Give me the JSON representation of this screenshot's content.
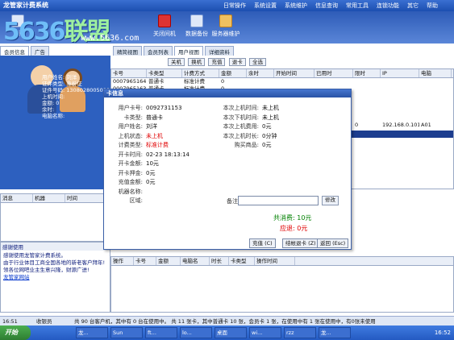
{
  "window": {
    "title": "龙管家计费系统"
  },
  "menubar": [
    "日常操作",
    "系统设置",
    "系统维护",
    "信息查询",
    "常用工具",
    "连锁功能",
    "其它",
    "帮助"
  ],
  "toolbar": {
    "items": [
      "新",
      "关闭间机",
      "数据备份",
      "服务器维护"
    ]
  },
  "logo": {
    "digits": "5636",
    "cn": "联盟",
    "website": "www.5636.com"
  },
  "left_tabs": [
    "会员信息",
    "广告"
  ],
  "top_tabs": [
    "精简视图",
    "会员列表",
    "用户视图",
    "详细资料"
  ],
  "action_buttons": [
    "关机",
    "换机",
    "充值",
    "退卡",
    "全选"
  ],
  "user_panel": {
    "fields": [
      {
        "label": "用户姓名:",
        "value": "刘洋"
      },
      {
        "label": "证件类型:",
        "value": "身份证"
      },
      {
        "label": "证件号码:",
        "value": "130802800508021"
      },
      {
        "label": "上机时间:",
        "value": ""
      },
      {
        "label": "金额:",
        "value": "0"
      },
      {
        "label": "余时:",
        "value": ""
      },
      {
        "label": "电脑名称:",
        "value": ""
      }
    ]
  },
  "grid": {
    "columns": [
      "卡号",
      "卡类型",
      "计费方式",
      "金额",
      "余时",
      "开始时间",
      "已用时",
      "限时",
      "IP",
      "电脑"
    ],
    "rows": [
      [
        "0007965164",
        "普通卡",
        "标准计费",
        "0",
        "",
        "",
        "",
        "",
        "",
        ""
      ],
      [
        "0007965163",
        "普通卡",
        "标准计费",
        "0",
        "",
        "",
        "",
        "",
        "",
        ""
      ],
      [
        "",
        "",
        "",
        "",
        "",
        "",
        "",
        "0",
        "192.168.0.101",
        "A01"
      ]
    ]
  },
  "msg_grid": {
    "columns": [
      "消息",
      "机器",
      "时间"
    ]
  },
  "log_grid": {
    "columns": [
      "操作",
      "卡号",
      "金额",
      "电脑名",
      "时长",
      "卡类型",
      "操作时间"
    ]
  },
  "welcome": {
    "title": "感谢使用",
    "lines": [
      "感谢使用龙管家计费系统。",
      "由于行业体目工商全国各地的新老客户拜年!",
      "领各位网吧业主生意兴隆，财源广进!",
      "龙管家网站"
    ]
  },
  "dialog": {
    "title": "卡信息",
    "left": [
      {
        "label": "用户卡号:",
        "value": "0092731153"
      },
      {
        "label": "卡类型:",
        "value": "普通卡"
      },
      {
        "label": "用户姓名:",
        "value": "刘洋"
      },
      {
        "label": "上机状态:",
        "value": "未上机",
        "red": true
      },
      {
        "label": "计费类型:",
        "value": "标准计费",
        "red": true
      },
      {
        "label": "开卡时间:",
        "value": "02-23 18:13:14"
      },
      {
        "label": "开卡金额:",
        "value": "10元"
      },
      {
        "label": "开卡押金:",
        "value": "0元"
      },
      {
        "label": "充值金额:",
        "value": "0元"
      },
      {
        "label": "机器名称:",
        "value": ""
      },
      {
        "label": "区域:",
        "value": ""
      }
    ],
    "right": [
      {
        "label": "本次上机时间:",
        "value": "未上机"
      },
      {
        "label": "本次下机时间:",
        "value": "未上机"
      },
      {
        "label": "本次上机费用:",
        "value": "0元"
      },
      {
        "label": "本次上机时长:",
        "value": "0分钟"
      },
      {
        "label": "购买商品:",
        "value": "0元"
      }
    ],
    "remark_label": "备注:",
    "remark_value": "",
    "modify_btn": "修改",
    "total_label": "共消费:",
    "total_value": "10元",
    "refund_label": "应退:",
    "refund_value": "0元",
    "buttons": [
      "充值 (C)",
      "结帐退卡 (Z)",
      "返回 (Esc)"
    ]
  },
  "status": {
    "time": "16:51",
    "operator": "收银员",
    "summary": "共 90 台客户机，其中有 0 台在使用中。  共 11 张卡，其中普通卡 10 张，会员卡 1 张，在使用中有 1 张在使用中，有0张未使用"
  },
  "taskbar": {
    "start": "开始",
    "tasks": [
      "龙...",
      "Sun",
      "ft...",
      "lo...",
      "桌面",
      "wi...",
      "rzz",
      "龙..."
    ],
    "clock": "16:52"
  }
}
